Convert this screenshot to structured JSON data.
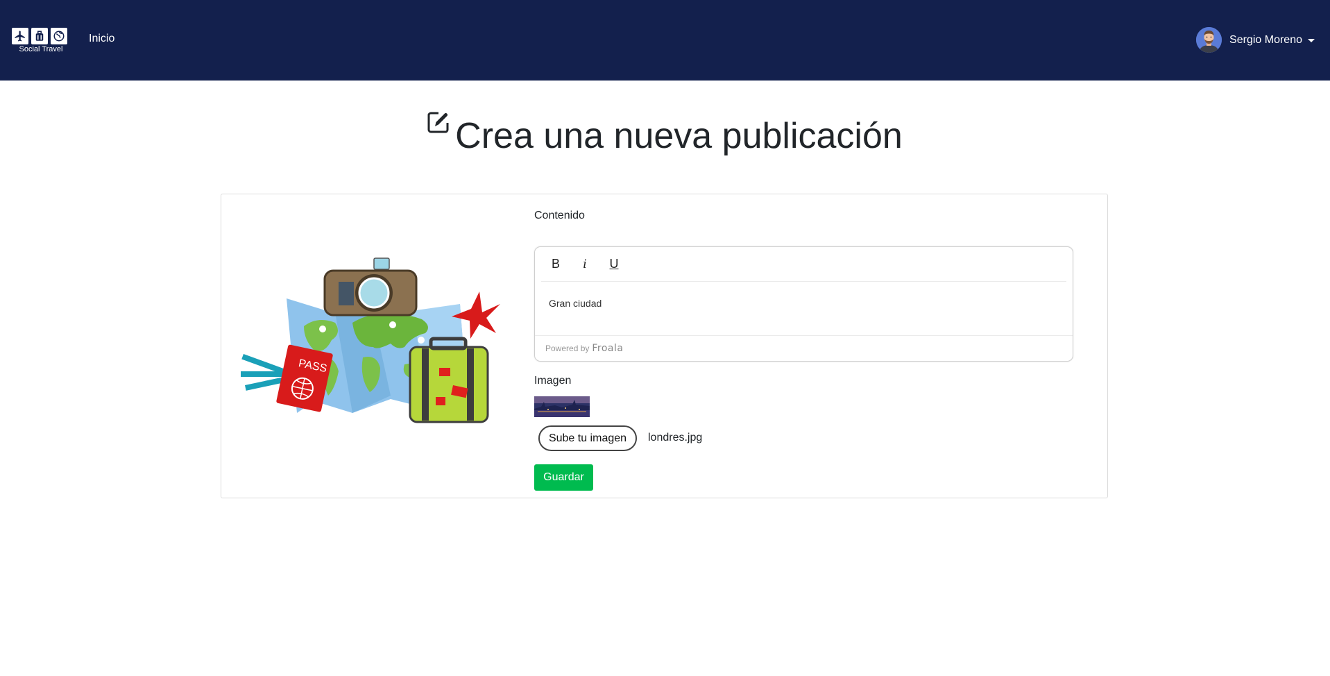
{
  "navbar": {
    "brand_text": "Social Travel",
    "home_link": "Inicio",
    "user_name": "Sergio Moreno",
    "background": "#13204d"
  },
  "page": {
    "title": "Crea una nueva publicación",
    "title_icon": "edit-square-icon"
  },
  "form": {
    "content_label": "Contenido",
    "editor": {
      "toolbar": {
        "bold": "B",
        "italic": "i",
        "underline": "U"
      },
      "content": "Gran ciudad",
      "powered_by": "Powered by",
      "powered_brand": "Froala"
    },
    "image_label": "Imagen",
    "upload_button": "Sube tu imagen",
    "file_name": "londres.jpg",
    "save_button": "Guardar",
    "save_color": "#00bb4f"
  }
}
